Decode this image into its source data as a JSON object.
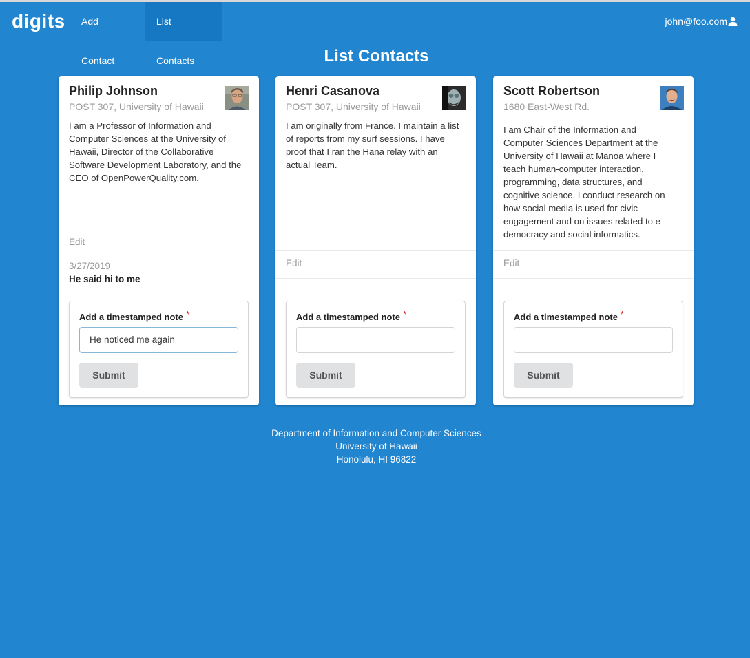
{
  "navbar": {
    "brand": "digits",
    "items": [
      {
        "label": "Add Contact",
        "active": false
      },
      {
        "label": "List Contacts",
        "active": true
      }
    ],
    "user": "john@foo.com",
    "user_icon": "user-icon"
  },
  "page": {
    "title": "List Contacts"
  },
  "contacts": [
    {
      "name": "Philip Johnson",
      "address": "POST 307, University of Hawaii",
      "description": "I am a Professor of Information and Computer Sciences at the University of Hawaii, Director of the Collaborative Software Development Laboratory, and the CEO of OpenPowerQuality.com.",
      "edit_label": "Edit",
      "notes": [
        {
          "date": "3/27/2019",
          "text": "He said hi to me"
        }
      ],
      "form": {
        "label": "Add a timestamped note",
        "required_mark": "*",
        "value": "He noticed me again",
        "submit_label": "Submit"
      }
    },
    {
      "name": "Henri Casanova",
      "address": "POST 307, University of Hawaii",
      "description": "I am originally from France. I maintain a list of reports from my surf sessions. I have proof that I ran the Hana relay with an actual Team.",
      "edit_label": "Edit",
      "notes": [],
      "form": {
        "label": "Add a timestamped note",
        "required_mark": "*",
        "value": "",
        "submit_label": "Submit"
      }
    },
    {
      "name": "Scott Robertson",
      "address": "1680 East-West Rd.",
      "description": "I am Chair of the Information and Computer Sciences Department at the University of Hawaii at Manoa where I teach human-computer interaction, programming, data structures, and cognitive science. I conduct research on how social media is used for civic engagement and on issues related to e-democracy and social informatics.",
      "edit_label": "Edit",
      "notes": [],
      "form": {
        "label": "Add a timestamped note",
        "required_mark": "*",
        "value": "",
        "submit_label": "Submit"
      }
    }
  ],
  "footer": {
    "line1": "Department of Information and Computer Sciences",
    "line2": "University of Hawaii",
    "line3": "Honolulu, HI 96822"
  },
  "colors": {
    "background": "#2185d0",
    "active_nav": "#1678c2",
    "card": "#ffffff",
    "required": "#db2828",
    "button": "#e0e1e2"
  }
}
